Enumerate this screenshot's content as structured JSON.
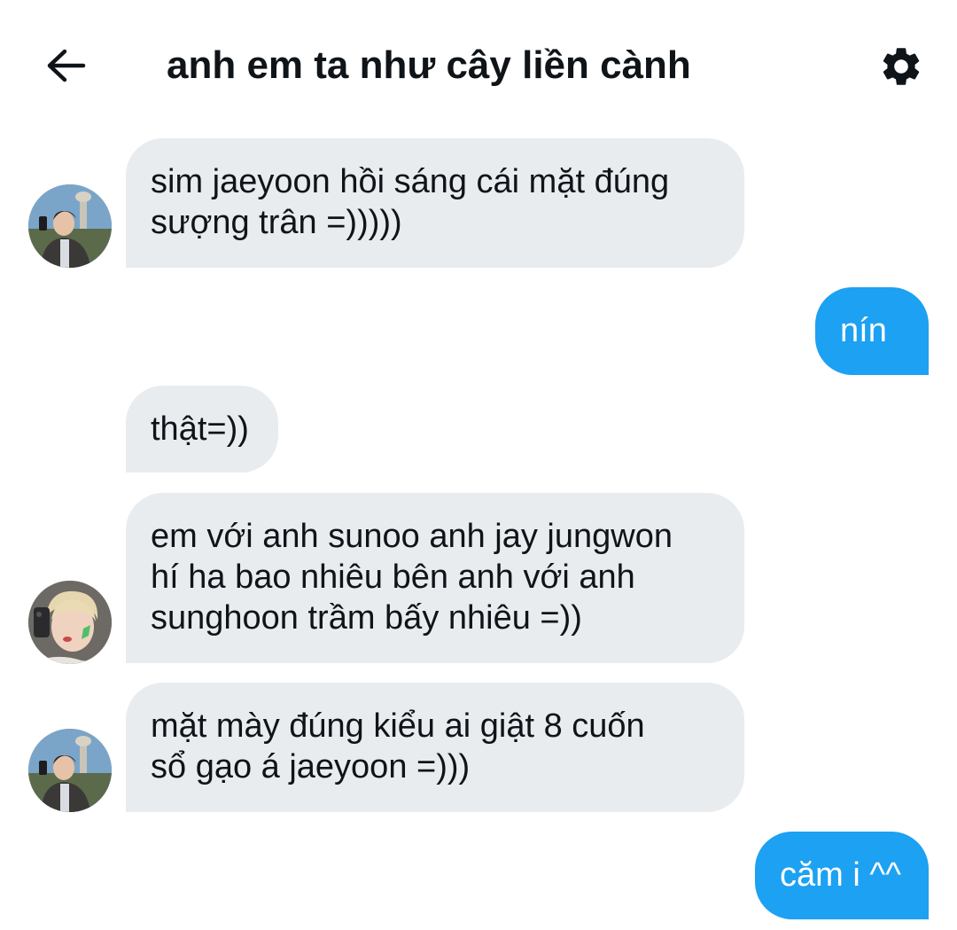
{
  "header": {
    "title": "anh em ta như cây liền cành",
    "back_icon": "arrow-left-icon",
    "settings_icon": "gear-icon"
  },
  "colors": {
    "incoming_bubble": "#e8ecef",
    "outgoing_bubble": "#1da1f2",
    "text": "#0f1419"
  },
  "messages": [
    {
      "direction": "incoming",
      "avatar": "jaeyoon",
      "lines": [
        "sim jaeyoon hồi sáng cái mặt đúng",
        "sượng trân =)))))"
      ]
    },
    {
      "direction": "outgoing",
      "lines": [
        "nín"
      ]
    },
    {
      "direction": "incoming",
      "avatar": "",
      "lines": [
        "thật=))"
      ]
    },
    {
      "direction": "incoming",
      "avatar": "jungwon",
      "lines": [
        "em với anh sunoo anh jay jungwon",
        "hí ha bao nhiêu bên anh với anh",
        "sunghoon trầm bấy nhiêu =))"
      ]
    },
    {
      "direction": "incoming",
      "avatar": "jaeyoon",
      "lines": [
        "mặt mày đúng kiểu ai giật 8 cuốn",
        "sổ gạo á jaeyoon =)))"
      ]
    },
    {
      "direction": "outgoing",
      "lines": [
        "căm i ^^"
      ]
    }
  ]
}
